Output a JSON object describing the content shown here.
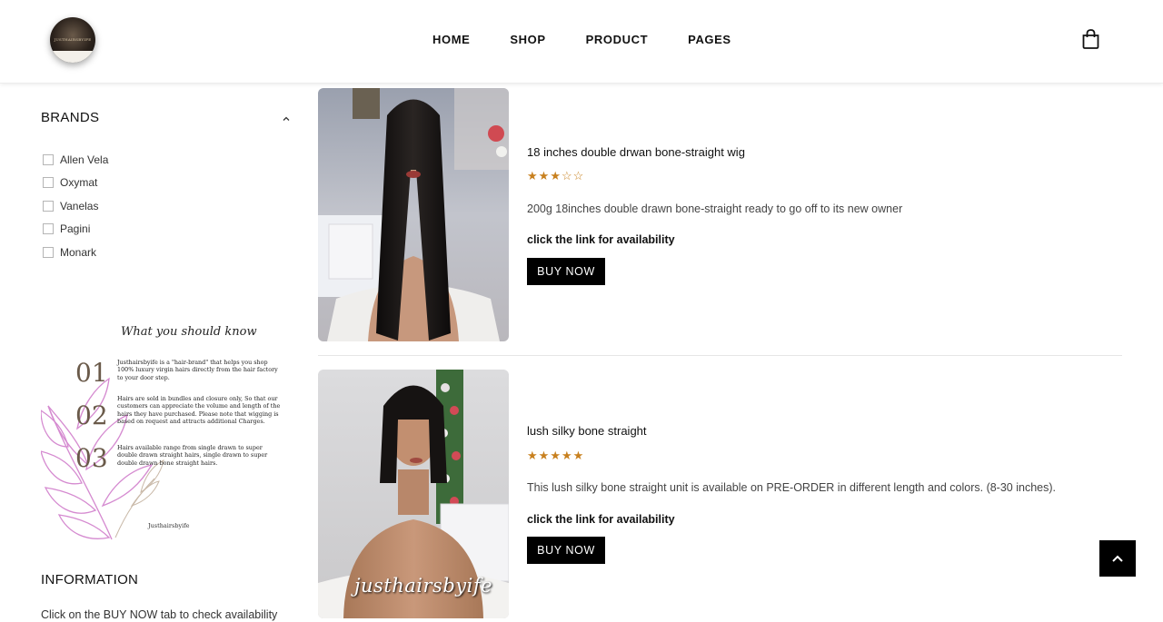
{
  "header": {
    "logo_text": "JUSTHAIRSBYIFE",
    "nav": [
      "HOME",
      "SHOP",
      "PRODUCT",
      "PAGES"
    ],
    "cart_icon": "shopping-bag-icon"
  },
  "sidebar": {
    "brands_title": "BRANDS",
    "brands": [
      "Allen Vela",
      "Oxymat",
      "Vanelas",
      "Pagini",
      "Monark"
    ],
    "banner": {
      "heading": "What you should know",
      "items": [
        {
          "num": "01",
          "text": "Justhairsbyife is a \"hair-brand\" that helps you shop 100% luxury virgin hairs directly from the hair factory to your door step."
        },
        {
          "num": "02",
          "text": "Hairs are sold in bundles and closure only, So that our customers can appreciate the volume and length of the hairs they have purchased. Please note that wigging is based on request and attracts additional Charges."
        },
        {
          "num": "03",
          "text": "Hairs available range from single drawn to super double drawn straight hairs, single drawn to super double drawn bone straight hairs."
        }
      ],
      "signature": "Justhairsbyife"
    },
    "info_title": "INFORMATION",
    "info_text": "Click on the BUY NOW tab to check availability"
  },
  "products": [
    {
      "title": "18 inches double drwan bone-straight wig",
      "rating": 3,
      "rating_max": 5,
      "description": "200g 18inches double drawn bone-straight ready to go off to its new owner",
      "link_text": "click the link for availability",
      "button": "BUY NOW"
    },
    {
      "title": "lush silky bone straight",
      "rating": 5,
      "rating_max": 5,
      "description": "This lush silky bone straight unit is available on PRE-ORDER in different length and colors. (8-30 inches).",
      "link_text": "click the link for availability",
      "button": "BUY NOW",
      "image_watermark": "justhairsbyife"
    }
  ],
  "colors": {
    "accent": "#000000",
    "star": "#c8801e",
    "banner_floral": "#d58ad0"
  }
}
